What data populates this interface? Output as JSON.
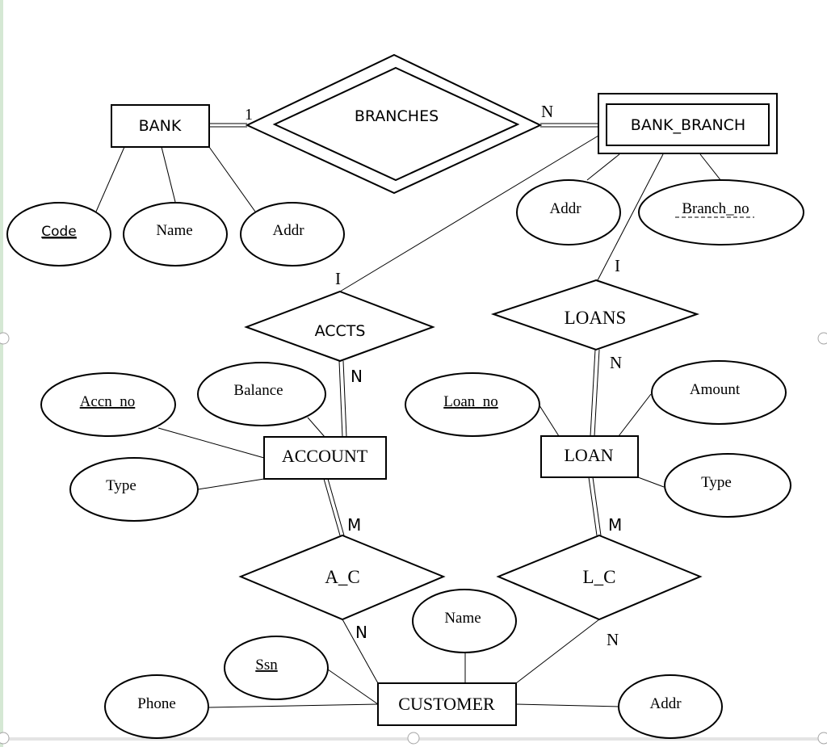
{
  "diagram": {
    "type": "ER diagram",
    "entities": {
      "bank": {
        "label": "BANK"
      },
      "bank_branch": {
        "label": "BANK_BRANCH",
        "weak": true
      },
      "account": {
        "label": "ACCOUNT"
      },
      "loan": {
        "label": "LOAN"
      },
      "customer": {
        "label": "CUSTOMER"
      }
    },
    "relationships": {
      "branches": {
        "label": "BRANCHES",
        "identifying": true
      },
      "accts": {
        "label": "ACCTS"
      },
      "loans": {
        "label": "LOANS"
      },
      "a_c": {
        "label": "A_C"
      },
      "l_c": {
        "label": "L_C"
      }
    },
    "attributes": {
      "bank_code": {
        "label": "Code",
        "key": true
      },
      "bank_name": {
        "label": "Name"
      },
      "bank_addr": {
        "label": "Addr"
      },
      "branch_addr": {
        "label": "Addr"
      },
      "branch_no": {
        "label": "Branch_no",
        "partial_key": true
      },
      "accn_no": {
        "label": "Accn_no",
        "key": true
      },
      "balance": {
        "label": "Balance"
      },
      "account_type": {
        "label": "Type"
      },
      "loan_no": {
        "label": "Loan_no",
        "key": true
      },
      "amount": {
        "label": "Amount"
      },
      "loan_type": {
        "label": "Type"
      },
      "ssn": {
        "label": "Ssn",
        "key": true
      },
      "customer_name": {
        "label": "Name"
      },
      "phone": {
        "label": "Phone"
      },
      "customer_addr": {
        "label": "Addr"
      }
    },
    "cardinalities": {
      "bank_branches": "1",
      "branches_bank_branch": "N",
      "bank_branch_accts": "I",
      "accts_account": "N",
      "bank_branch_loans": "I",
      "loans_loan": "N",
      "account_a_c": "M",
      "a_c_customer": "N",
      "loan_l_c": "M",
      "l_c_customer": "N"
    }
  }
}
